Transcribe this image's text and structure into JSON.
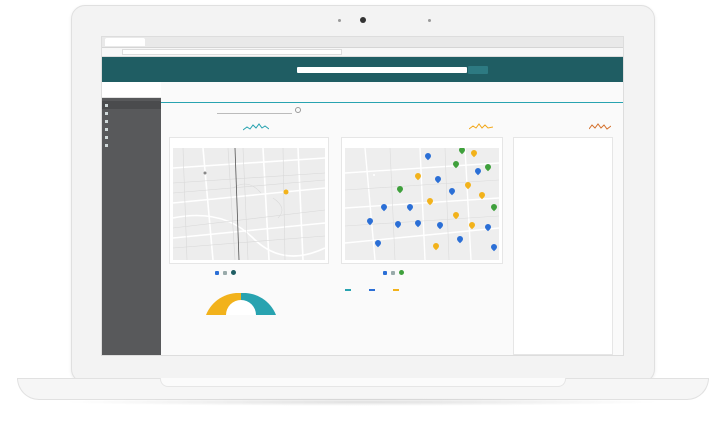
{
  "browser": {
    "tab_title": "",
    "url": ""
  },
  "header": {
    "logo_text": "",
    "search_placeholder": "",
    "search_button": ""
  },
  "sidebar": {
    "user_name": "",
    "user_role": "",
    "items": [
      {
        "label": "",
        "active": true
      },
      {
        "label": ""
      },
      {
        "label": ""
      },
      {
        "label": ""
      },
      {
        "label": ""
      },
      {
        "label": ""
      }
    ]
  },
  "main": {
    "page_title": "",
    "top_link": "",
    "filter_label": "",
    "filter_placeholder": "",
    "kpis": [
      {
        "value": "",
        "sub": ""
      },
      {
        "value": "",
        "sub": ""
      },
      {
        "value": "",
        "sub": ""
      },
      {
        "value": "",
        "sub": ""
      },
      {
        "value": "",
        "sub": ""
      }
    ],
    "map_left": {
      "title": ""
    },
    "map_right": {
      "title": "",
      "popup_line1": "",
      "popup_line2": ""
    },
    "lower_left": {
      "label": "",
      "legend_title": "",
      "legend": [
        "",
        "",
        ""
      ]
    },
    "lower_right": {
      "label": "",
      "legend_title": "",
      "legend": [
        "",
        "",
        ""
      ]
    }
  },
  "alerts": {
    "title": "",
    "items": [
      {
        "head": "",
        "sub": ""
      },
      {
        "head": "",
        "sub": ""
      },
      {
        "head": "",
        "sub": ""
      },
      {
        "head": "",
        "sub": ""
      },
      {
        "head": "",
        "sub": ""
      },
      {
        "head": "",
        "sub": ""
      }
    ]
  },
  "colors": {
    "header": "#1f5d63",
    "sidebar": "#58595b",
    "accent_teal": "#28a3b0",
    "accent_orange": "#d4712d",
    "pin_blue": "#2b6fd6",
    "pin_yellow": "#f2b21b",
    "pin_green": "#3fa03c"
  }
}
